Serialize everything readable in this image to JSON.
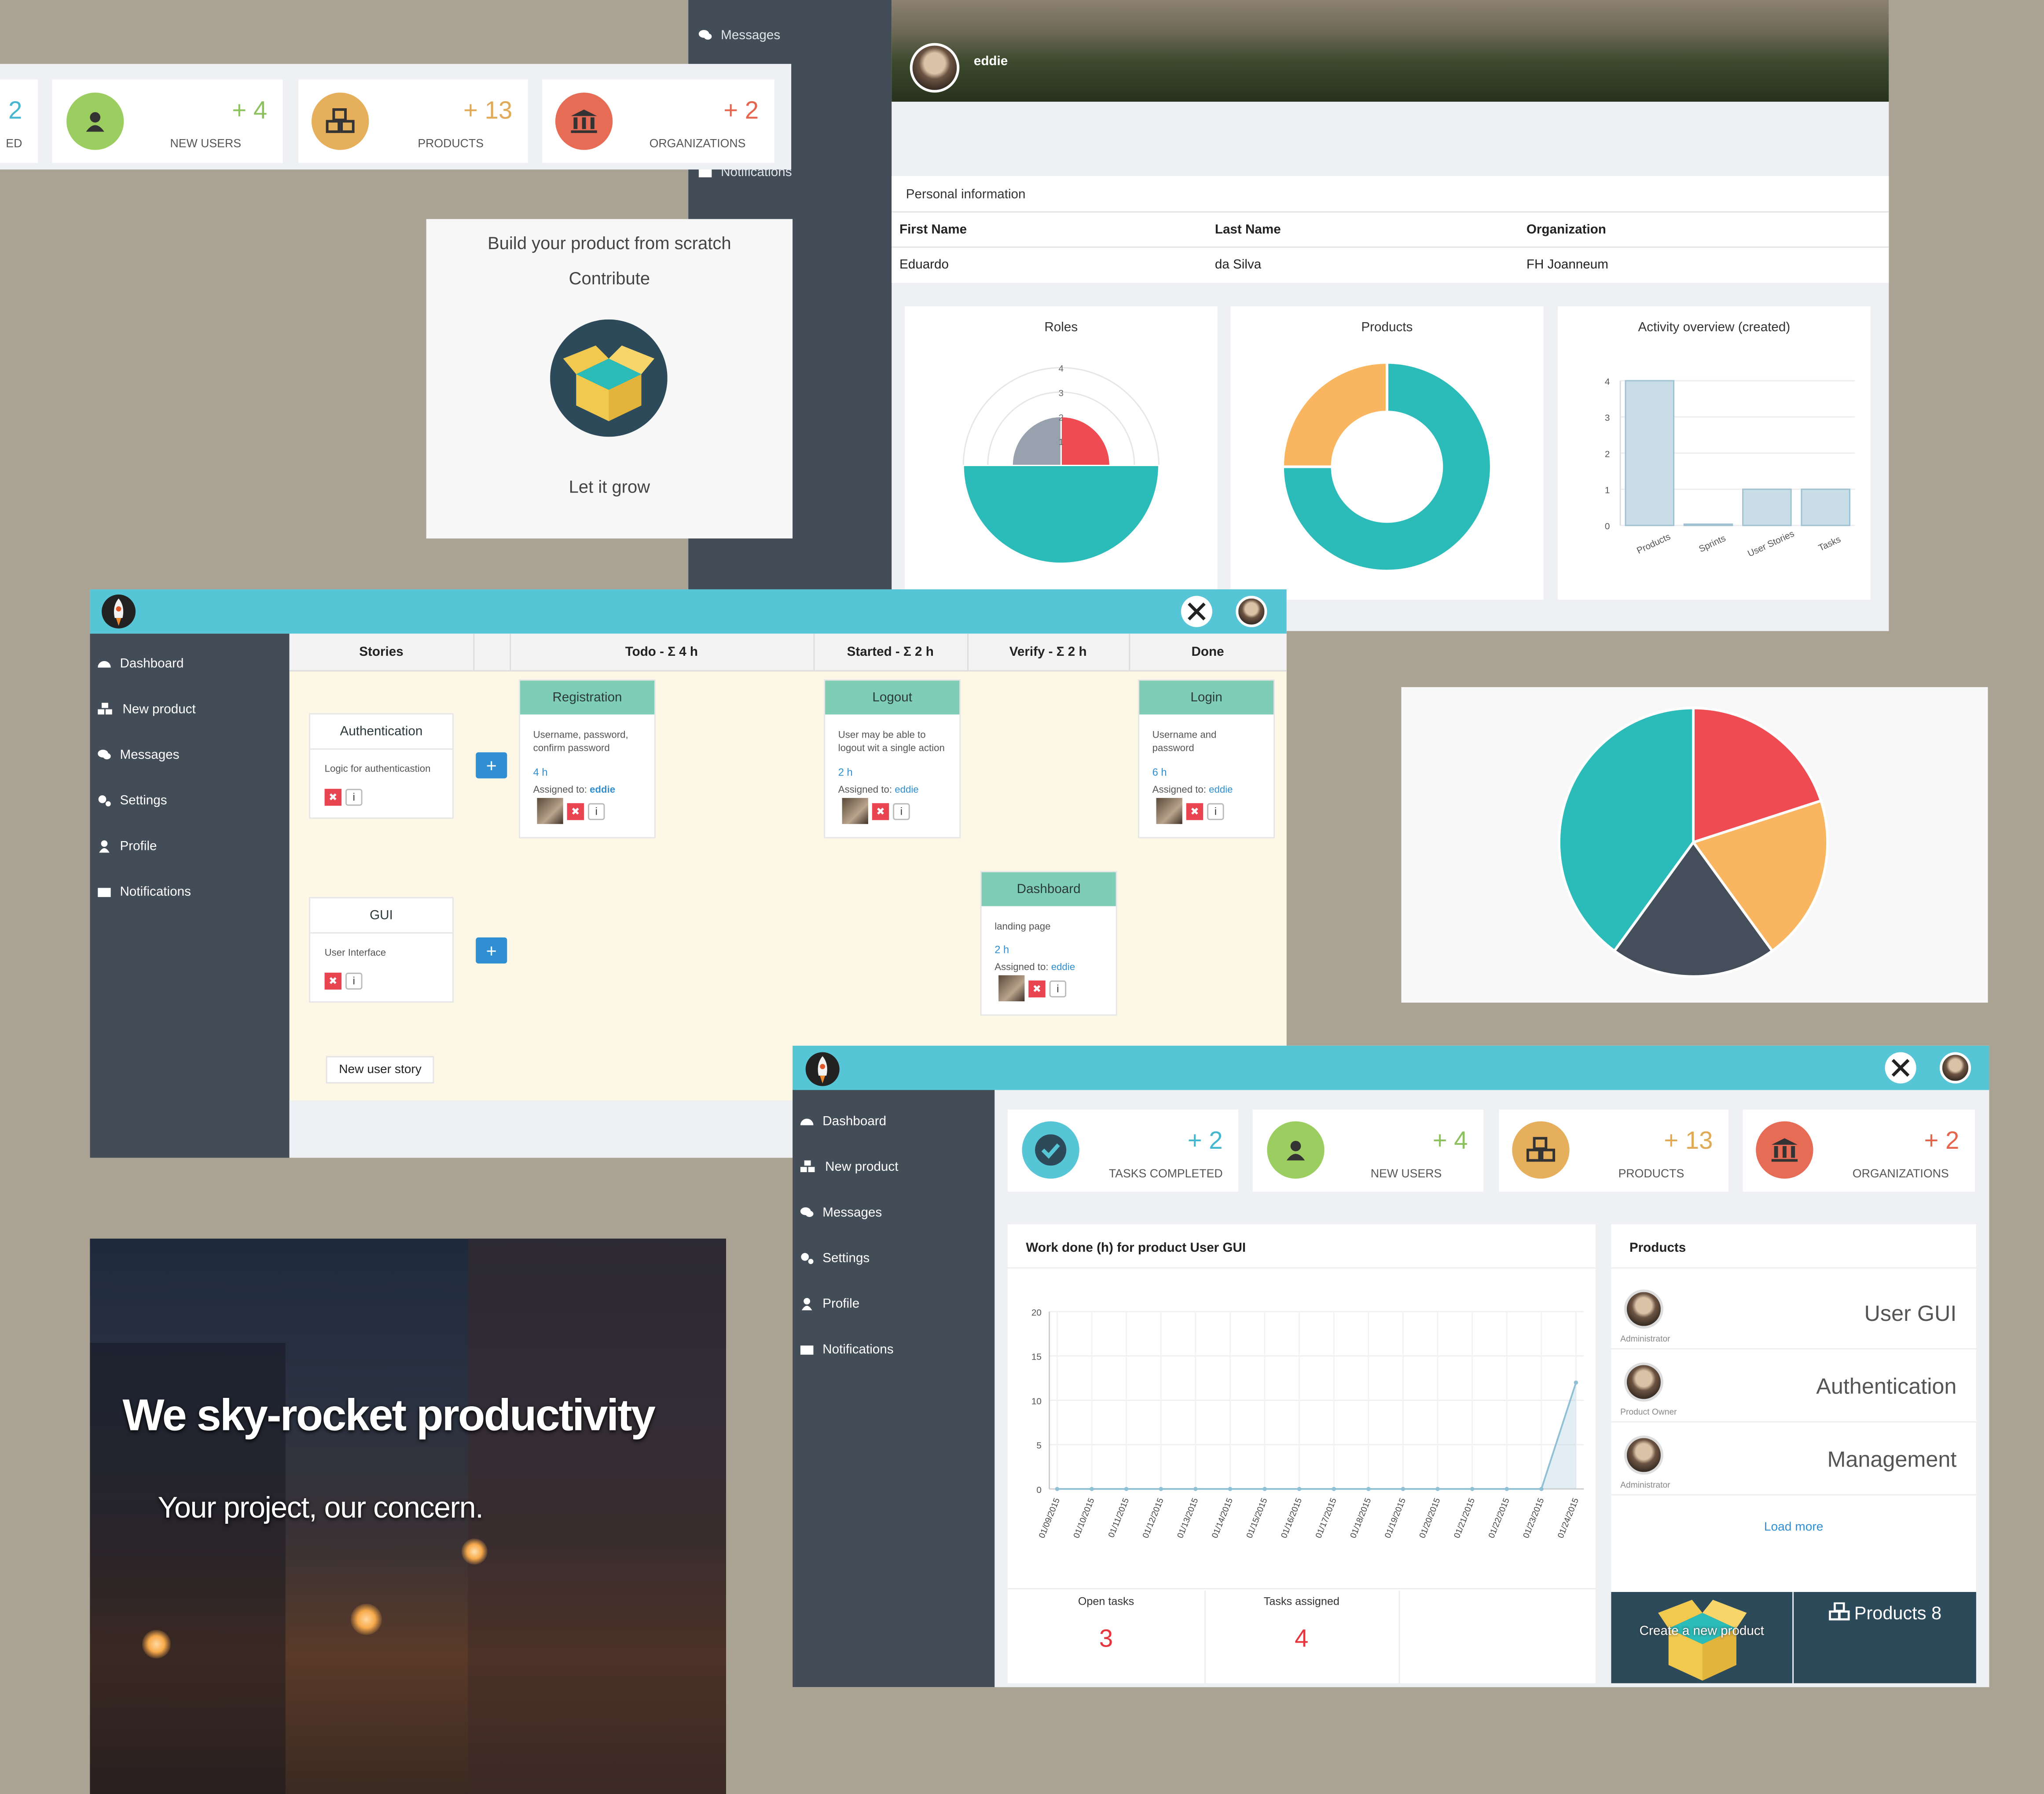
{
  "colors": {
    "teal": "#2bbbb8",
    "red": "#ee4c52",
    "orange": "#f9b55f",
    "dark": "#454f5b",
    "sidebar": "#434d58",
    "topbar": "#56c5d6",
    "green": "#9ccd61",
    "gold": "#e5af5c",
    "coral": "#e76c56"
  },
  "top_stats": {
    "items": [
      {
        "number": "2",
        "label": "ED",
        "icon": "check-icon"
      },
      {
        "number": "+ 4",
        "label": "NEW USERS",
        "icon": "user-icon"
      },
      {
        "number": "+ 13",
        "label": "PRODUCTS",
        "icon": "boxes-icon"
      },
      {
        "number": "+ 2",
        "label": "ORGANIZATIONS",
        "icon": "bank-icon"
      }
    ]
  },
  "profile_window": {
    "menu_messages": "Messages",
    "menu_notifications": "Notifications",
    "username": "eddie",
    "section_title": "Personal information",
    "headers": [
      "First Name",
      "Last Name",
      "Organization"
    ],
    "values": [
      "Eduardo",
      "da Silva",
      "FH Joanneum"
    ],
    "roles_title": "Roles",
    "roles_ticks": [
      "4",
      "3",
      "2",
      "1"
    ],
    "products_title": "Products",
    "activity_title": "Activity overview (created)"
  },
  "build_card": {
    "line1": "Build your product from scratch",
    "line2": "Contribute",
    "line3": "Let it grow"
  },
  "chart_data": [
    {
      "type": "pie",
      "title": "Roles",
      "polar": true,
      "slices": [
        {
          "value": 2,
          "color": "#ee4c52"
        },
        {
          "value": 4,
          "color": "#2bbbb8"
        },
        {
          "value": 2,
          "color": "#97a2ae"
        }
      ],
      "ticks": [
        1,
        2,
        3,
        4
      ]
    },
    {
      "type": "pie",
      "title": "Products",
      "donut": true,
      "slices": [
        {
          "value": 75,
          "color": "#2bbbb8"
        },
        {
          "value": 25,
          "color": "#f9b55f"
        }
      ]
    },
    {
      "type": "bar",
      "title": "Activity overview (created)",
      "categories": [
        "Products",
        "Sprints",
        "User Stories",
        "Tasks"
      ],
      "values": [
        4,
        0,
        1,
        1
      ],
      "ylim": [
        0,
        4
      ],
      "yticks": [
        0,
        1,
        2,
        3,
        4
      ]
    },
    {
      "type": "pie",
      "slices": [
        {
          "value": 20,
          "color": "#ee4c52"
        },
        {
          "value": 20,
          "color": "#f9b55f"
        },
        {
          "value": 20,
          "color": "#454f5b"
        },
        {
          "value": 40,
          "color": "#2bbbb8"
        }
      ]
    },
    {
      "type": "line",
      "title": "Work done (h) for product User GUI",
      "x": [
        "01/09/2015",
        "01/10/2015",
        "01/11/2015",
        "01/12/2015",
        "01/13/2015",
        "01/14/2015",
        "01/15/2015",
        "01/16/2015",
        "01/17/2015",
        "01/18/2015",
        "01/19/2015",
        "01/20/2015",
        "01/21/2015",
        "01/22/2015",
        "01/23/2015",
        "01/24/2015"
      ],
      "values": [
        0,
        0,
        0,
        0,
        0,
        0,
        0,
        0,
        0,
        0,
        0,
        0,
        0,
        0,
        0,
        12
      ],
      "ylim": [
        0,
        20
      ],
      "yticks": [
        0,
        5,
        10,
        15,
        20
      ]
    }
  ],
  "scrum": {
    "nav": [
      "Dashboard",
      "New product",
      "Messages",
      "Settings",
      "Profile",
      "Notifications"
    ],
    "columns": [
      "Stories",
      "Todo - Σ 4 h",
      "Started - Σ 2 h",
      "Verify - Σ 2 h",
      "Done"
    ],
    "stories": [
      {
        "title": "Authentication",
        "desc": "Logic for authenticastion"
      },
      {
        "title": "GUI",
        "desc": "User Interface"
      }
    ],
    "tasks": [
      {
        "title": "Registration",
        "desc": "Username, password, confirm password",
        "hours": "4 h",
        "assigned_label": "Assigned to:",
        "assignee": "eddie"
      },
      {
        "title": "Logout",
        "desc": "User may be able to logout wit a single action",
        "hours": "2 h",
        "assigned_label": "Assigned to:",
        "assignee": "eddie"
      },
      {
        "title": "Login",
        "desc": "Username and password",
        "hours": "6 h",
        "assigned_label": "Assigned to:",
        "assignee": "eddie"
      },
      {
        "title": "Dashboard",
        "desc": "landing page",
        "hours": "2 h",
        "assigned_label": "Assigned to:",
        "assignee": "eddie"
      }
    ],
    "plus": "+",
    "new_story": "New user story"
  },
  "hero": {
    "title": "We sky-rocket productivity",
    "subtitle": "Your project, our concern."
  },
  "dashboard": {
    "nav": [
      "Dashboard",
      "New product",
      "Messages",
      "Settings",
      "Profile",
      "Notifications"
    ],
    "stats": [
      {
        "number": "+ 2",
        "label": "TASKS COMPLETED",
        "icon": "check-icon"
      },
      {
        "number": "+ 4",
        "label": "NEW USERS",
        "icon": "user-icon"
      },
      {
        "number": "+ 13",
        "label": "PRODUCTS",
        "icon": "boxes-icon"
      },
      {
        "number": "+ 2",
        "label": "ORGANIZATIONS",
        "icon": "bank-icon"
      }
    ],
    "work_title": "Work done (h) for product User GUI",
    "open_tasks_label": "Open tasks",
    "open_tasks": "3",
    "tasks_assigned_label": "Tasks assigned",
    "tasks_assigned": "4",
    "products_title": "Products",
    "products": [
      {
        "name": "User GUI",
        "role": "Administrator"
      },
      {
        "name": "Authentication",
        "role": "Product Owner"
      },
      {
        "name": "Management",
        "role": "Administrator"
      }
    ],
    "load_more": "Load more",
    "create_product": "Create a new product",
    "products_count": "Products 8"
  }
}
